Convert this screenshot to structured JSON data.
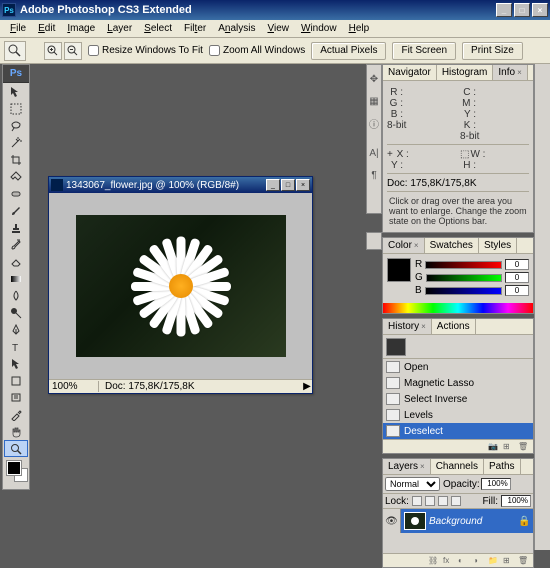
{
  "app": {
    "title": "Adobe Photoshop CS3 Extended",
    "ps_badge": "Ps"
  },
  "menu": {
    "items": [
      "File",
      "Edit",
      "Image",
      "Layer",
      "Select",
      "Filter",
      "Analysis",
      "View",
      "Window",
      "Help"
    ]
  },
  "options": {
    "resize_label": "Resize Windows To Fit",
    "zoom_all_label": "Zoom All Windows",
    "actual_pixels": "Actual Pixels",
    "fit_screen": "Fit Screen",
    "print_size": "Print Size"
  },
  "doc": {
    "title": "1343067_flower.jpg @ 100% (RGB/8#)",
    "zoom": "100%",
    "status_doc": "Doc: 175,8K/175,8K"
  },
  "info_panel": {
    "tabs": [
      "Navigator",
      "Histogram",
      "Info"
    ],
    "r": "R :",
    "g": "G :",
    "b": "B :",
    "bits1": "8-bit",
    "c": "C :",
    "m": "M :",
    "y": "Y :",
    "k": "K :",
    "bits2": "8-bit",
    "x": "X :",
    "y2": "Y :",
    "w": "W :",
    "h": "H :",
    "doc": "Doc: 175,8K/175,8K",
    "hint": "Click or drag over the area you want to enlarge. Change the zoom state on the Options bar."
  },
  "color_panel": {
    "tabs": [
      "Color",
      "Swatches",
      "Styles"
    ],
    "r": "R",
    "g": "G",
    "b": "B",
    "r_val": "0",
    "g_val": "0",
    "b_val": "0"
  },
  "history_panel": {
    "tabs": [
      "History",
      "Actions"
    ],
    "items": [
      "Open",
      "Magnetic Lasso",
      "Select Inverse",
      "Levels",
      "Deselect"
    ]
  },
  "layers_panel": {
    "tabs": [
      "Layers",
      "Channels",
      "Paths"
    ],
    "blend": "Normal",
    "opacity_label": "Opacity:",
    "opacity_val": "100%",
    "lock_label": "Lock:",
    "fill_label": "Fill:",
    "fill_val": "100%",
    "layer_name": "Background"
  }
}
